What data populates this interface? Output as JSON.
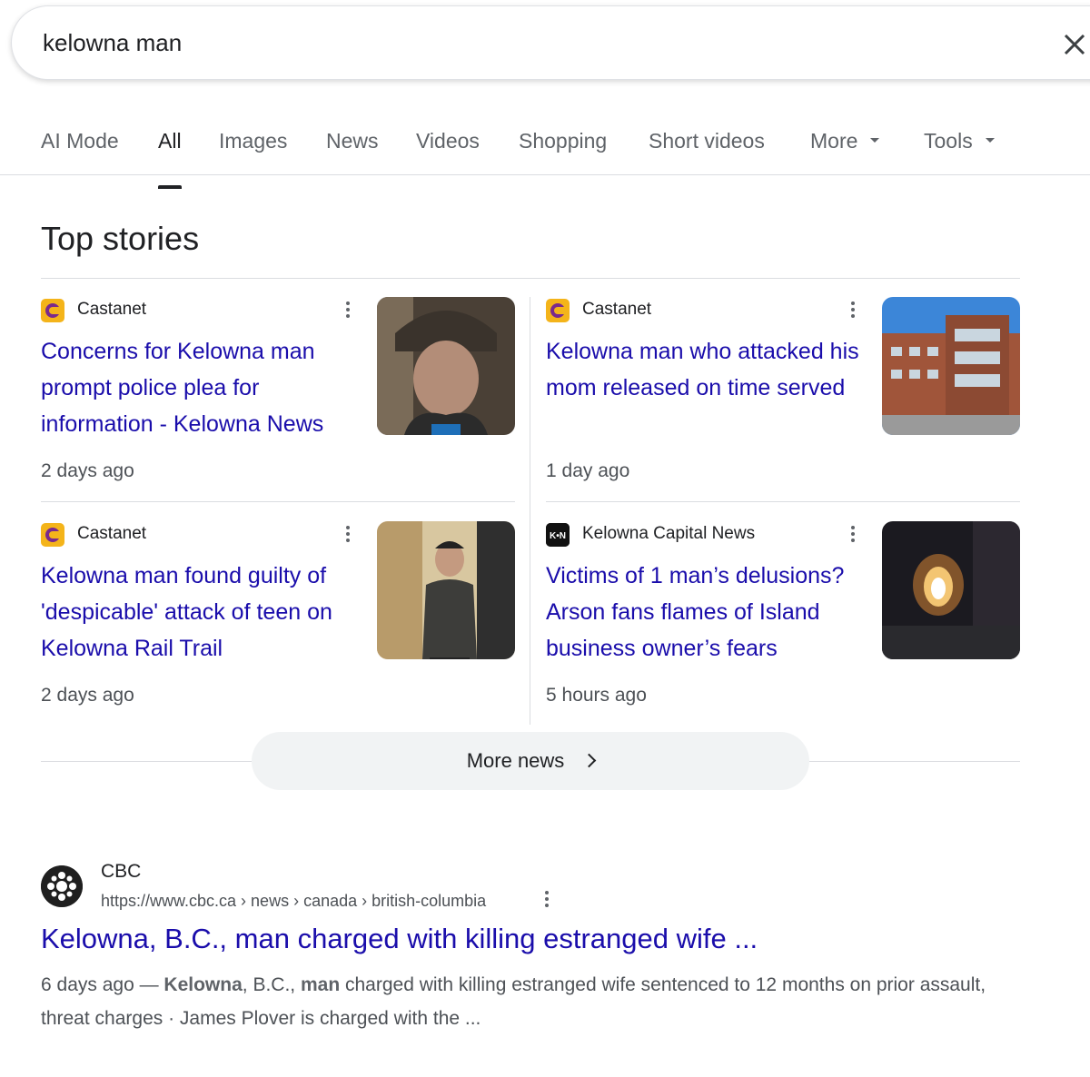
{
  "search": {
    "query": "kelowna man"
  },
  "tabs": [
    {
      "label": "AI Mode"
    },
    {
      "label": "All"
    },
    {
      "label": "Images"
    },
    {
      "label": "News"
    },
    {
      "label": "Videos"
    },
    {
      "label": "Shopping"
    },
    {
      "label": "Short videos"
    },
    {
      "label": "More"
    },
    {
      "label": "Tools"
    }
  ],
  "active_tab": "All",
  "top_stories": {
    "title": "Top stories",
    "stories": [
      {
        "source": "Castanet",
        "headline": "Concerns for Kelowna man prompt police plea for information - Kelowna News",
        "age": "2 days ago",
        "icon": "castanet-icon",
        "image": "man-in-cap-photo"
      },
      {
        "source": "Castanet",
        "headline": "Kelowna man who attacked his mom released on time served",
        "age": "1 day ago",
        "icon": "castanet-icon",
        "image": "courthouse-photo"
      },
      {
        "source": "Castanet",
        "headline": "Kelowna man found guilty of 'despicable' attack of teen on Kelowna Rail Trail",
        "age": "2 days ago",
        "icon": "castanet-icon",
        "image": "man-in-jacket-photo"
      },
      {
        "source": "Kelowna Capital News",
        "headline": "Victims of 1 man’s delusions? Arson fans flames of Island business owner’s fears",
        "age": "5 hours ago",
        "icon": "kcn-icon",
        "icon_text": "K•N",
        "image": "fire-at-night-photo"
      }
    ],
    "more_news_label": "More news"
  },
  "result": {
    "source": "CBC",
    "url": "https://www.cbc.ca › news › canada › british-columbia",
    "title": "Kelowna, B.C., man charged with killing estranged wife ...",
    "snippet_date": "6 days ago",
    "snippet_sep": " — ",
    "snippet_bold_1": "Kelowna",
    "snippet_text_1": ", B.C., ",
    "snippet_bold_2": "man",
    "snippet_text_2": " charged with killing estranged wife sentenced to 12 months on prior assault, threat charges · James Plover is charged with the ..."
  },
  "colors": {
    "link": "#1a0dab",
    "text": "#202124",
    "muted": "#4d5156",
    "divider": "#dadce0"
  }
}
